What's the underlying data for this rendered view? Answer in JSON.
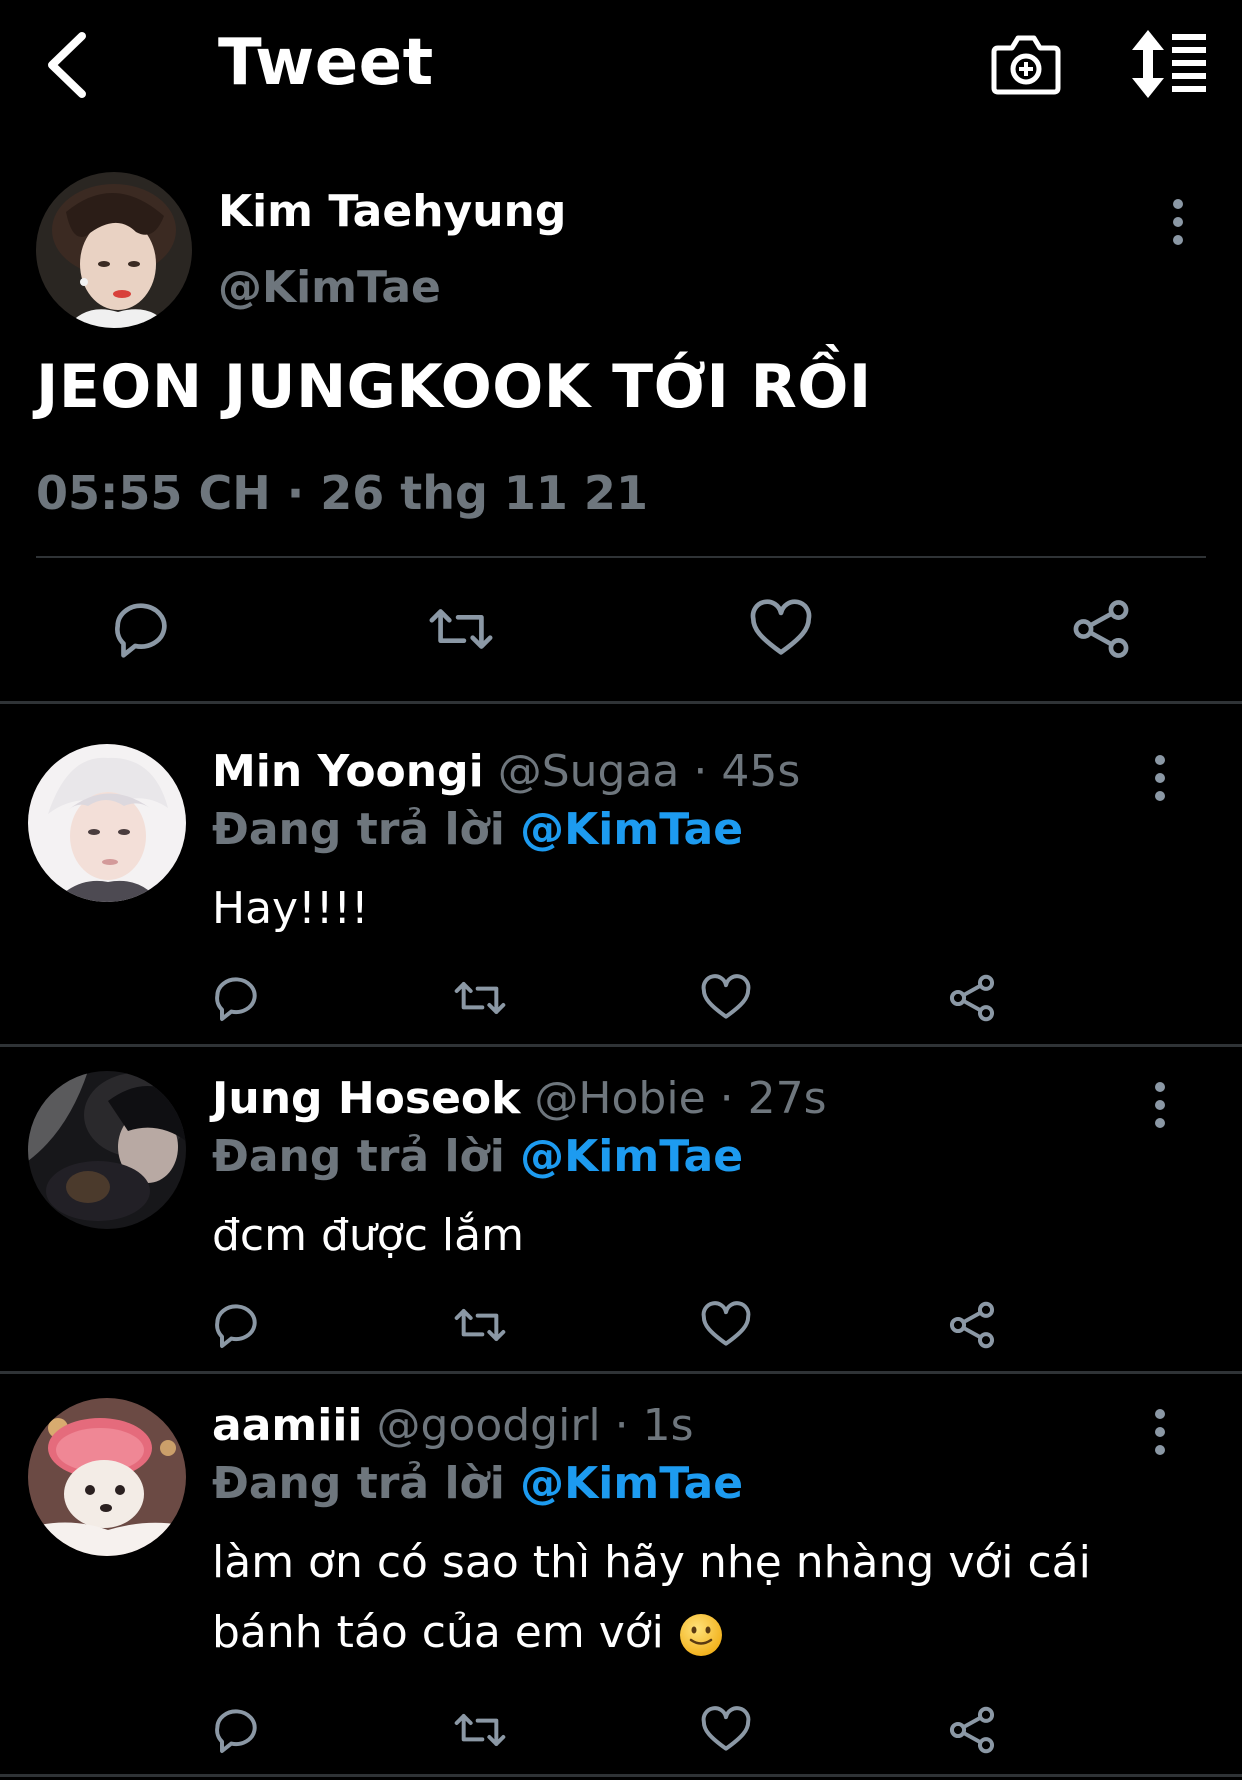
{
  "header": {
    "title": "Tweet",
    "back_icon": "chevron-left-icon",
    "camera_icon": "camera-add-icon",
    "sort_icon": "sort-lines-icon"
  },
  "tweet": {
    "author_name": "Kim Taehyung",
    "author_handle": "@KimTae",
    "text": "JEON JUNGKOOK TỚI RỒI",
    "timestamp": "05:55 CH · 26 thg 11 21"
  },
  "replying_label": "Đang trả lời",
  "replies": [
    {
      "name": "Min Yoongi",
      "meta": "@Sugaa · 45s",
      "mention": "@KimTae",
      "text": "Hay!!!!"
    },
    {
      "name": "Jung Hoseok",
      "meta": "@Hobie · 27s",
      "mention": "@KimTae",
      "text": "đcm được lắm"
    },
    {
      "name": "aamiii",
      "meta": "@goodgirl · 1s",
      "mention": "@KimTae",
      "text": "làm ơn có sao thì hãy nhẹ nhàng với cái bánh táo của em với"
    }
  ],
  "colors": {
    "background": "#000000",
    "text": "#ffffff",
    "muted": "#6e767d",
    "link": "#1d9bf0",
    "divider": "#2f3336"
  }
}
